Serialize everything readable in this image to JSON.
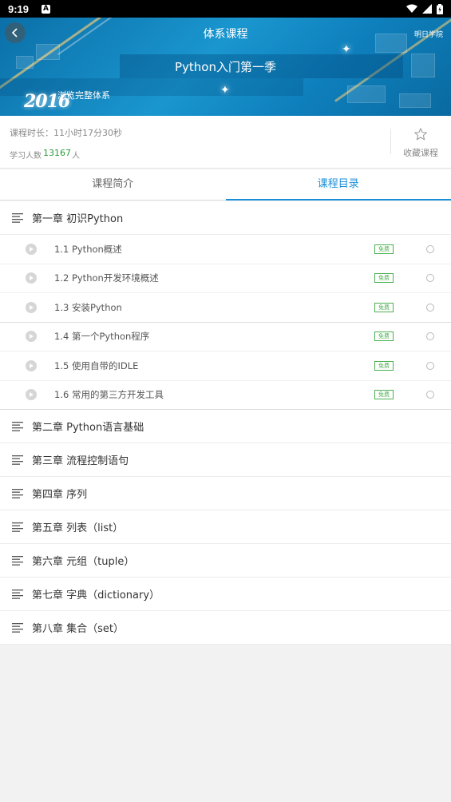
{
  "status_bar": {
    "time": "9:19",
    "app_icon": "A"
  },
  "banner": {
    "header": "体系课程",
    "brand": "明日学院",
    "course_title": "Python入门第一季",
    "subtitle": "浏览完整体系",
    "year": "2016"
  },
  "info": {
    "duration": "课程时长：11小时17分30秒",
    "students_label": "学习人数",
    "students_count": "13167",
    "students_unit": "人",
    "favorite_label": "收藏课程"
  },
  "tabs": [
    {
      "label": "课程简介",
      "active": false
    },
    {
      "label": "课程目录",
      "active": true
    }
  ],
  "chapters": [
    {
      "title": "第一章 初识Python",
      "lessons": [
        {
          "title": "1.1 Python概述",
          "badge": "免费"
        },
        {
          "title": "1.2 Python开发环境概述",
          "badge": "免费"
        },
        {
          "title": "1.3 安装Python",
          "badge": "免费"
        },
        {
          "title": "1.4 第一个Python程序",
          "badge": "免费"
        },
        {
          "title": "1.5 使用自带的IDLE",
          "badge": "免费"
        },
        {
          "title": "1.6 常用的第三方开发工具",
          "badge": "免费"
        }
      ]
    },
    {
      "title": "第二章 Python语言基础"
    },
    {
      "title": "第三章 流程控制语句"
    },
    {
      "title": "第四章 序列"
    },
    {
      "title": "第五章 列表（list）"
    },
    {
      "title": "第六章 元组（tuple）"
    },
    {
      "title": "第七章 字典（dictionary）"
    },
    {
      "title": "第八章 集合（set）"
    }
  ],
  "colors": {
    "accent": "#1a8fd8",
    "count": "#2a9d3a",
    "badge": "#4caf50"
  },
  "icons": {
    "back": "chevron-left-icon",
    "favorite": "star-outline-icon",
    "chapter": "list-lines-icon",
    "lesson": "play-circle-icon"
  }
}
